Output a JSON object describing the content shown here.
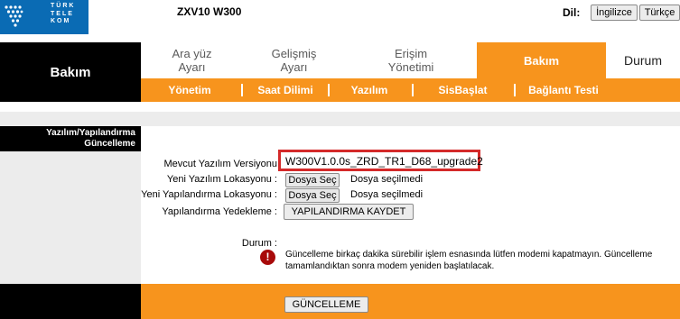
{
  "header": {
    "logo_lines": [
      "TÜRK",
      "TELE",
      "KOM"
    ],
    "model": "ZXV10 W300",
    "lang_label": "Dil:",
    "lang_options": [
      "İngilizce",
      "Türkçe"
    ]
  },
  "nav": {
    "section_title": "Bakım",
    "tabs": [
      {
        "line1": "Ara yüz",
        "line2": "Ayarı"
      },
      {
        "line1": "Gelişmiş",
        "line2": "Ayarı"
      },
      {
        "line1": "Erişim",
        "line2": "Yönetimi"
      },
      {
        "line1": "Bakım",
        "line2": ""
      },
      {
        "line1": "Durum",
        "line2": ""
      }
    ],
    "active_tab": "Bakım",
    "subtabs": [
      "Yönetim",
      "Saat Dilimi",
      "Yazılım",
      "SisBaşlat",
      "Bağlantı Testi"
    ]
  },
  "panel": {
    "title_line1": "Yazılım/Yapılandırma",
    "title_line2": "Güncelleme"
  },
  "form": {
    "current_version_label": "Mevcut Yazılım Versiyonu",
    "current_version_value": "W300V1.0.0s_ZRD_TR1_D68_upgrade2",
    "new_software_label": "Yeni Yazılım Lokasyonu :",
    "new_config_label": "Yeni Yapılandırma Lokasyonu :",
    "choose_file_label": "Dosya Seç",
    "no_file_text": "Dosya seçilmedi",
    "backup_label": "Yapılandırma Yedekleme :",
    "save_config_button": "YAPILANDIRMA KAYDET",
    "status_label": "Durum :",
    "status_message": "Güncelleme birkaç dakika sürebilir işlem esnasında lütfen modemi kapatmayın. Güncelleme tamamlandıktan sonra modem yeniden başlatılacak."
  },
  "footer": {
    "update_button": "GÜNCELLEME"
  },
  "colors": {
    "accent_orange": "#f7941d",
    "brand_blue": "#0a6bb4",
    "highlight_red": "#d42a2a",
    "warning_red": "#a80a0a"
  }
}
